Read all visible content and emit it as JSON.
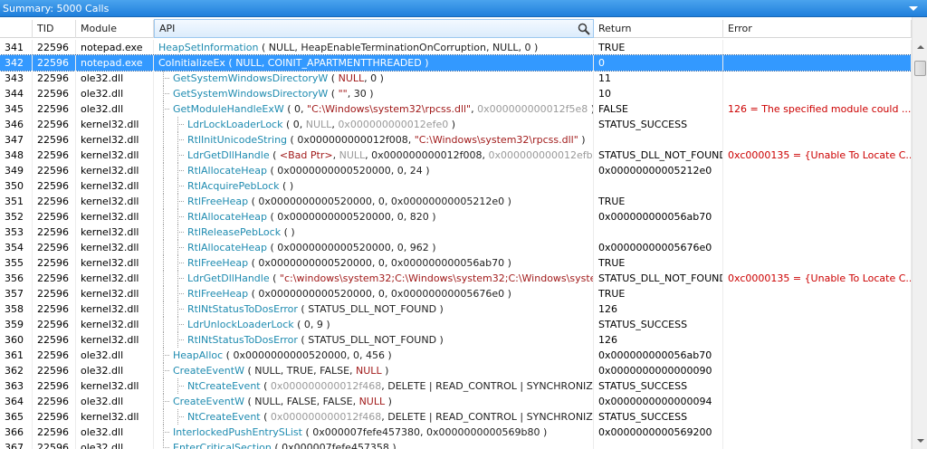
{
  "window": {
    "title": "Summary: 5000 Calls"
  },
  "columns": [
    {
      "key": "idx",
      "label": ""
    },
    {
      "key": "tid",
      "label": "TID"
    },
    {
      "key": "module",
      "label": "Module"
    },
    {
      "key": "api",
      "label": "API"
    },
    {
      "key": "return",
      "label": "Return"
    },
    {
      "key": "error",
      "label": "Error"
    }
  ],
  "icons": {
    "search": "magnifier-icon",
    "collapse": "chevron-down-icon"
  },
  "selected_row": "342",
  "rows": [
    {
      "idx": "341",
      "tid": "22596",
      "module": "notepad.exe",
      "depth": 0,
      "api": [
        [
          "n",
          "HeapSetInformation"
        ],
        [
          "p",
          " ( NULL, HeapEnableTerminationOnCorruption, NULL, 0 )"
        ]
      ],
      "ret": "TRUE",
      "err": ""
    },
    {
      "idx": "342",
      "tid": "22596",
      "module": "notepad.exe",
      "depth": 0,
      "api": [
        [
          "n",
          "CoInitializeEx"
        ],
        [
          "p",
          " ( NULL, COINIT_APARTMENTTHREADED )"
        ]
      ],
      "ret": "0",
      "err": ""
    },
    {
      "idx": "343",
      "tid": "22596",
      "module": "ole32.dll",
      "depth": 1,
      "api": [
        [
          "n",
          "GetSystemWindowsDirectoryW"
        ],
        [
          "p",
          " ( "
        ],
        [
          "s",
          "NULL"
        ],
        [
          "p",
          ", 0 )"
        ]
      ],
      "ret": "11",
      "err": ""
    },
    {
      "idx": "344",
      "tid": "22596",
      "module": "ole32.dll",
      "depth": 1,
      "api": [
        [
          "n",
          "GetSystemWindowsDirectoryW"
        ],
        [
          "p",
          " ( "
        ],
        [
          "s",
          "\"\""
        ],
        [
          "p",
          ", 30 )"
        ]
      ],
      "ret": "10",
      "err": ""
    },
    {
      "idx": "345",
      "tid": "22596",
      "module": "ole32.dll",
      "depth": 1,
      "api": [
        [
          "n",
          "GetModuleHandleExW"
        ],
        [
          "p",
          " ( 0, "
        ],
        [
          "s",
          "\"C:\\Windows\\system32\\rpcss.dll\""
        ],
        [
          "p",
          ", "
        ],
        [
          "g",
          "0x000000000012f5e8"
        ],
        [
          "p",
          " )"
        ]
      ],
      "ret": "FALSE",
      "err": "126 = The specified module could ..."
    },
    {
      "idx": "346",
      "tid": "22596",
      "module": "kernel32.dll",
      "depth": 2,
      "api": [
        [
          "n",
          "LdrLockLoaderLock"
        ],
        [
          "p",
          " ( 0, "
        ],
        [
          "g",
          "NULL"
        ],
        [
          "p",
          ", "
        ],
        [
          "g",
          "0x000000000012efe0"
        ],
        [
          "p",
          " )"
        ]
      ],
      "ret": "STATUS_SUCCESS",
      "err": ""
    },
    {
      "idx": "347",
      "tid": "22596",
      "module": "kernel32.dll",
      "depth": 2,
      "api": [
        [
          "n",
          "RtlInitUnicodeString"
        ],
        [
          "p",
          " ( 0x000000000012f008, "
        ],
        [
          "s",
          "\"C:\\Windows\\system32\\rpcss.dll\""
        ],
        [
          "p",
          " )"
        ]
      ],
      "ret": "",
      "err": ""
    },
    {
      "idx": "348",
      "tid": "22596",
      "module": "kernel32.dll",
      "depth": 2,
      "api": [
        [
          "n",
          "LdrGetDllHandle"
        ],
        [
          "p",
          " ( "
        ],
        [
          "s",
          "<Bad Ptr>"
        ],
        [
          "p",
          ", "
        ],
        [
          "g",
          "NULL"
        ],
        [
          "p",
          ", 0x000000000012f008, "
        ],
        [
          "g",
          "0x000000000012efb8"
        ],
        [
          "p",
          " )"
        ]
      ],
      "ret": "STATUS_DLL_NOT_FOUND",
      "err": "0xc0000135 = {Unable To Locate C..."
    },
    {
      "idx": "349",
      "tid": "22596",
      "module": "kernel32.dll",
      "depth": 2,
      "api": [
        [
          "n",
          "RtlAllocateHeap"
        ],
        [
          "p",
          " ( 0x0000000000520000, 0, 24 )"
        ]
      ],
      "ret": "0x00000000005212e0",
      "err": ""
    },
    {
      "idx": "350",
      "tid": "22596",
      "module": "kernel32.dll",
      "depth": 2,
      "api": [
        [
          "n",
          "RtlAcquirePebLock"
        ],
        [
          "p",
          " ( )"
        ]
      ],
      "ret": "",
      "err": ""
    },
    {
      "idx": "351",
      "tid": "22596",
      "module": "kernel32.dll",
      "depth": 2,
      "api": [
        [
          "n",
          "RtlFreeHeap"
        ],
        [
          "p",
          " ( 0x0000000000520000, 0, 0x00000000005212e0 )"
        ]
      ],
      "ret": "TRUE",
      "err": ""
    },
    {
      "idx": "352",
      "tid": "22596",
      "module": "kernel32.dll",
      "depth": 2,
      "api": [
        [
          "n",
          "RtlAllocateHeap"
        ],
        [
          "p",
          " ( 0x0000000000520000, 0, 820 )"
        ]
      ],
      "ret": "0x000000000056ab70",
      "err": ""
    },
    {
      "idx": "353",
      "tid": "22596",
      "module": "kernel32.dll",
      "depth": 2,
      "api": [
        [
          "n",
          "RtlReleasePebLock"
        ],
        [
          "p",
          " ( )"
        ]
      ],
      "ret": "",
      "err": ""
    },
    {
      "idx": "354",
      "tid": "22596",
      "module": "kernel32.dll",
      "depth": 2,
      "api": [
        [
          "n",
          "RtlAllocateHeap"
        ],
        [
          "p",
          " ( 0x0000000000520000, 0, 962 )"
        ]
      ],
      "ret": "0x00000000005676e0",
      "err": ""
    },
    {
      "idx": "355",
      "tid": "22596",
      "module": "kernel32.dll",
      "depth": 2,
      "api": [
        [
          "n",
          "RtlFreeHeap"
        ],
        [
          "p",
          " ( 0x0000000000520000, 0, 0x000000000056ab70 )"
        ]
      ],
      "ret": "TRUE",
      "err": ""
    },
    {
      "idx": "356",
      "tid": "22596",
      "module": "kernel32.dll",
      "depth": 2,
      "api": [
        [
          "n",
          "LdrGetDllHandle"
        ],
        [
          "p",
          " ( "
        ],
        [
          "s",
          "\"c:\\windows\\system32;C:\\Windows\\system32;C:\\Windows\\system;..."
        ]
      ],
      "ret": "STATUS_DLL_NOT_FOUND",
      "err": "0xc0000135 = {Unable To Locate C..."
    },
    {
      "idx": "357",
      "tid": "22596",
      "module": "kernel32.dll",
      "depth": 2,
      "api": [
        [
          "n",
          "RtlFreeHeap"
        ],
        [
          "p",
          " ( 0x0000000000520000, 0, 0x00000000005676e0 )"
        ]
      ],
      "ret": "TRUE",
      "err": ""
    },
    {
      "idx": "358",
      "tid": "22596",
      "module": "kernel32.dll",
      "depth": 2,
      "api": [
        [
          "n",
          "RtlNtStatusToDosError"
        ],
        [
          "p",
          " ( STATUS_DLL_NOT_FOUND )"
        ]
      ],
      "ret": "126",
      "err": ""
    },
    {
      "idx": "359",
      "tid": "22596",
      "module": "kernel32.dll",
      "depth": 2,
      "api": [
        [
          "n",
          "LdrUnlockLoaderLock"
        ],
        [
          "p",
          " ( 0, 9 )"
        ]
      ],
      "ret": "STATUS_SUCCESS",
      "err": ""
    },
    {
      "idx": "360",
      "tid": "22596",
      "module": "kernel32.dll",
      "depth": 2,
      "api": [
        [
          "n",
          "RtlNtStatusToDosError"
        ],
        [
          "p",
          " ( STATUS_DLL_NOT_FOUND )"
        ]
      ],
      "ret": "126",
      "err": ""
    },
    {
      "idx": "361",
      "tid": "22596",
      "module": "ole32.dll",
      "depth": 1,
      "api": [
        [
          "n",
          "HeapAlloc"
        ],
        [
          "p",
          " ( 0x0000000000520000, 0, 456 )"
        ]
      ],
      "ret": "0x000000000056ab70",
      "err": ""
    },
    {
      "idx": "362",
      "tid": "22596",
      "module": "ole32.dll",
      "depth": 1,
      "api": [
        [
          "n",
          "CreateEventW"
        ],
        [
          "p",
          " ( NULL, TRUE, FALSE, "
        ],
        [
          "s",
          "NULL"
        ],
        [
          "p",
          " )"
        ]
      ],
      "ret": "0x0000000000000090",
      "err": ""
    },
    {
      "idx": "363",
      "tid": "22596",
      "module": "kernel32.dll",
      "depth": 2,
      "api": [
        [
          "n",
          "NtCreateEvent"
        ],
        [
          "p",
          " ( "
        ],
        [
          "g",
          "0x000000000012f468"
        ],
        [
          "p",
          ", DELETE | READ_CONTROL | SYNCHRONIZE | WR..."
        ]
      ],
      "ret": "STATUS_SUCCESS",
      "err": ""
    },
    {
      "idx": "364",
      "tid": "22596",
      "module": "ole32.dll",
      "depth": 1,
      "api": [
        [
          "n",
          "CreateEventW"
        ],
        [
          "p",
          " ( NULL, FALSE, FALSE, "
        ],
        [
          "s",
          "NULL"
        ],
        [
          "p",
          " )"
        ]
      ],
      "ret": "0x0000000000000094",
      "err": ""
    },
    {
      "idx": "365",
      "tid": "22596",
      "module": "kernel32.dll",
      "depth": 2,
      "api": [
        [
          "n",
          "NtCreateEvent"
        ],
        [
          "p",
          " ( "
        ],
        [
          "g",
          "0x000000000012f468"
        ],
        [
          "p",
          ", DELETE | READ_CONTROL | SYNCHRONIZE | WR..."
        ]
      ],
      "ret": "STATUS_SUCCESS",
      "err": ""
    },
    {
      "idx": "366",
      "tid": "22596",
      "module": "ole32.dll",
      "depth": 1,
      "api": [
        [
          "n",
          "InterlockedPushEntrySList"
        ],
        [
          "p",
          " ( 0x000007fefe457380, 0x0000000000569b80 )"
        ]
      ],
      "ret": "0x0000000000569200",
      "err": ""
    },
    {
      "idx": "367",
      "tid": "22596",
      "module": "ole32.dll",
      "depth": 1,
      "api": [
        [
          "n",
          "EnterCriticalSection"
        ],
        [
          "p",
          " ( 0x000007fefe457358 )"
        ]
      ],
      "ret": "",
      "err": ""
    }
  ]
}
